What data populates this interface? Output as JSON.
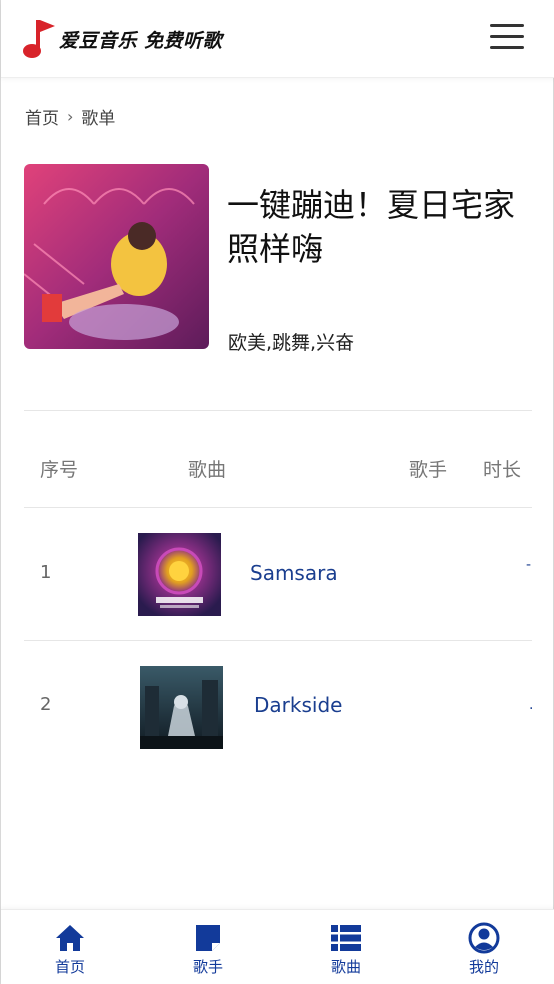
{
  "header": {
    "logo_text": "爱豆音乐 免费听歌",
    "menu_icon": "hamburger-menu-icon"
  },
  "breadcrumb": {
    "home": "首页",
    "current": "歌单"
  },
  "playlist": {
    "title": "一键蹦迪！夏日宅家照样嗨",
    "tags": "欧美,跳舞,兴奋"
  },
  "table": {
    "headers": {
      "index": "序号",
      "song": "歌曲",
      "singer": "歌手",
      "duration": "时长"
    },
    "rows": [
      {
        "index": "1",
        "name": "Samsara",
        "singer": "",
        "duration": "-"
      },
      {
        "index": "2",
        "name": "Darkside",
        "singer": "",
        "duration": "."
      }
    ]
  },
  "bottom_nav": [
    {
      "label": "首页",
      "icon": "home-icon"
    },
    {
      "label": "歌手",
      "icon": "note-icon"
    },
    {
      "label": "歌曲",
      "icon": "list-icon"
    },
    {
      "label": "我的",
      "icon": "user-icon"
    }
  ],
  "colors": {
    "accent": "#123a9a",
    "logo_red": "#d8232a",
    "song_link": "#1a3e8f"
  }
}
